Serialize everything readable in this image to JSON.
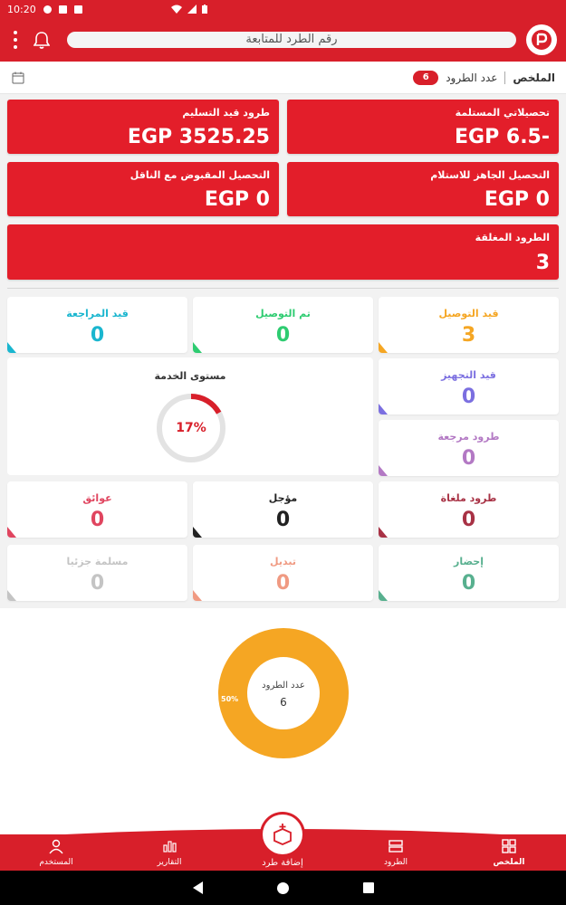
{
  "status_bar": {
    "time": "10:20"
  },
  "header": {
    "search_placeholder": "رقم الطرد للمتابعة"
  },
  "summary_strip": {
    "summary_label": "الملخص",
    "count_label": "عدد الطرود",
    "count_value": "6"
  },
  "red_cards": {
    "my_collections": {
      "title": "تحصيلاتي المستلمة",
      "value": "EGP 6.5-"
    },
    "under_delivery": {
      "title": "طرود قيد التسليم",
      "value": "EGP 3525.25"
    },
    "ready_collection": {
      "title": "التحصيل الجاهز للاستلام",
      "value": "EGP 0"
    },
    "carrier_collection": {
      "title": "التحصيل المقبوض مع الناقل",
      "value": "EGP 0"
    },
    "closed_parcels": {
      "title": "الطرود المغلقة",
      "value": "3"
    }
  },
  "status_cards": {
    "in_delivery": {
      "title": "قيد التوصيل",
      "value": "3",
      "color": "#f5a623"
    },
    "delivered": {
      "title": "تم التوصيل",
      "value": "0",
      "color": "#2ecc71"
    },
    "under_review": {
      "title": "قيد المراجعة",
      "value": "0",
      "color": "#1ab6cf"
    },
    "preparing": {
      "title": "قيد التجهيز",
      "value": "0",
      "color": "#7b6fe0"
    },
    "returned": {
      "title": "طرود مرجعة",
      "value": "0",
      "color": "#b379c4"
    },
    "cancelled": {
      "title": "طرود ملغاة",
      "value": "0",
      "color": "#a83245"
    },
    "postponed": {
      "title": "مؤجل",
      "value": "0",
      "color": "#222222"
    },
    "obstacles": {
      "title": "عوائق",
      "value": "0",
      "color": "#e0455f"
    },
    "pickup": {
      "title": "إحضار",
      "value": "0",
      "color": "#58b08f"
    },
    "exchange": {
      "title": "تبديل",
      "value": "0",
      "color": "#f09a82"
    },
    "partial": {
      "title": "مسلمة جزئيا",
      "value": "0",
      "color": "#c4c4c4"
    }
  },
  "service_level": {
    "title": "مستوى الخدمة",
    "percent_label": "17%",
    "percent": 17
  },
  "donut": {
    "center_label": "عدد الطرود",
    "center_value": "6",
    "slice_label": "50%",
    "color": "#f5a623"
  },
  "bottom_nav": {
    "summary": "الملخص",
    "parcels": "الطرود",
    "add_parcel": "إضافة طرد",
    "reports": "التقارير",
    "user": "المستخدم"
  },
  "colors": {
    "brand_red": "#d81f2a"
  }
}
